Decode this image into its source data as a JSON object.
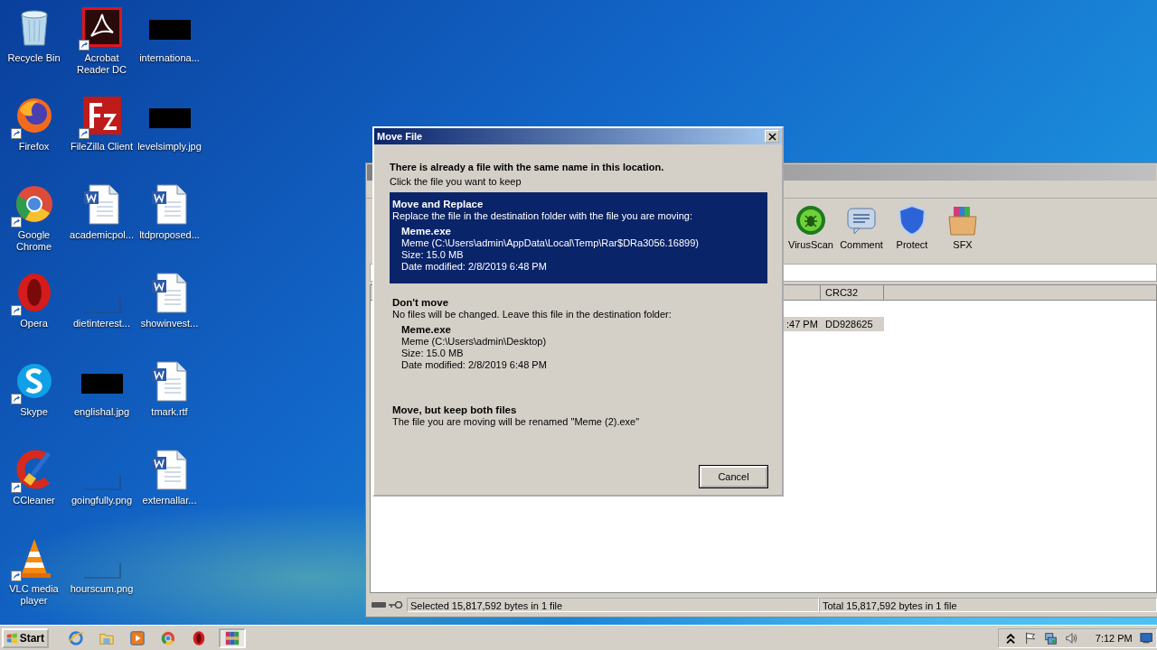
{
  "desktop_icons": [
    {
      "label": "Recycle Bin",
      "kind": "recycle",
      "shortcut": false
    },
    {
      "label": "Firefox",
      "kind": "firefox",
      "shortcut": true
    },
    {
      "label": "Google Chrome",
      "kind": "chrome",
      "shortcut": true
    },
    {
      "label": "Opera",
      "kind": "opera",
      "shortcut": true
    },
    {
      "label": "Skype",
      "kind": "skype",
      "shortcut": true
    },
    {
      "label": "CCleaner",
      "kind": "ccleaner",
      "shortcut": true
    },
    {
      "label": "VLC media player",
      "kind": "vlc",
      "shortcut": true
    },
    {
      "label": "Acrobat Reader DC",
      "kind": "acrobat",
      "shortcut": true
    },
    {
      "label": "FileZilla Client",
      "kind": "filezilla",
      "shortcut": true
    },
    {
      "label": "academicpol...",
      "kind": "word",
      "shortcut": false
    },
    {
      "label": "dietinterest...",
      "kind": "blank",
      "shortcut": false
    },
    {
      "label": "englishal.jpg",
      "kind": "dark-image",
      "shortcut": false
    },
    {
      "label": "goingfully.png",
      "kind": "blank",
      "shortcut": false
    },
    {
      "label": "hourscum.png",
      "kind": "blank",
      "shortcut": false
    },
    {
      "label": "internationa...",
      "kind": "dark-image",
      "shortcut": false
    },
    {
      "label": "levelsimply.jpg",
      "kind": "dark-image",
      "shortcut": false
    },
    {
      "label": "ltdproposed...",
      "kind": "word",
      "shortcut": false
    },
    {
      "label": "showinvest...",
      "kind": "word",
      "shortcut": false
    },
    {
      "label": "tmark.rtf",
      "kind": "word",
      "shortcut": false
    },
    {
      "label": "externallar...",
      "kind": "word",
      "shortcut": false
    }
  ],
  "archiver": {
    "toolbar": [
      {
        "label": "VirusScan",
        "kind": "virus"
      },
      {
        "label": "Comment",
        "kind": "comment"
      },
      {
        "label": "Protect",
        "kind": "protect"
      },
      {
        "label": "SFX",
        "kind": "sfx"
      }
    ],
    "columns": [
      "CRC32"
    ],
    "rows": [
      {
        "time": ":47 PM",
        "crc": "DD928625",
        "selected": true
      }
    ],
    "status_left": "Selected 15,817,592 bytes in 1 file",
    "status_right": "Total 15,817,592 bytes in 1 file"
  },
  "dialog": {
    "title": "Move File",
    "heading": "There is already a file with the same name in this location.",
    "subheading": "Click the file you want to keep",
    "options": [
      {
        "title": "Move and Replace",
        "description": "Replace the file in the destination folder with the file you are moving:",
        "selected": true,
        "file": {
          "name": "Meme.exe",
          "location": "Meme (C:\\Users\\admin\\AppData\\Local\\Temp\\Rar$DRa3056.16899)",
          "size": "Size: 15.0 MB",
          "modified": "Date modified: 2/8/2019 6:48 PM"
        }
      },
      {
        "title": "Don't move",
        "description": "No files will be changed. Leave this file in the destination folder:",
        "selected": false,
        "file": {
          "name": "Meme.exe",
          "location": "Meme (C:\\Users\\admin\\Desktop)",
          "size": "Size: 15.0 MB",
          "modified": "Date modified: 2/8/2019 6:48 PM"
        }
      },
      {
        "title": "Move, but keep both files",
        "description": "The file you are moving will be renamed \"Meme (2).exe\"",
        "selected": false
      }
    ],
    "buttons": [
      "Cancel"
    ]
  },
  "taskbar": {
    "start": "Start",
    "apps": [
      {
        "kind": "ie",
        "selected": false
      },
      {
        "kind": "explorer",
        "selected": false
      },
      {
        "kind": "media",
        "selected": false
      },
      {
        "kind": "chrome",
        "selected": false
      },
      {
        "kind": "opera",
        "selected": false
      },
      {
        "kind": "archiver",
        "selected": true
      }
    ],
    "clock": "7:12 PM"
  }
}
